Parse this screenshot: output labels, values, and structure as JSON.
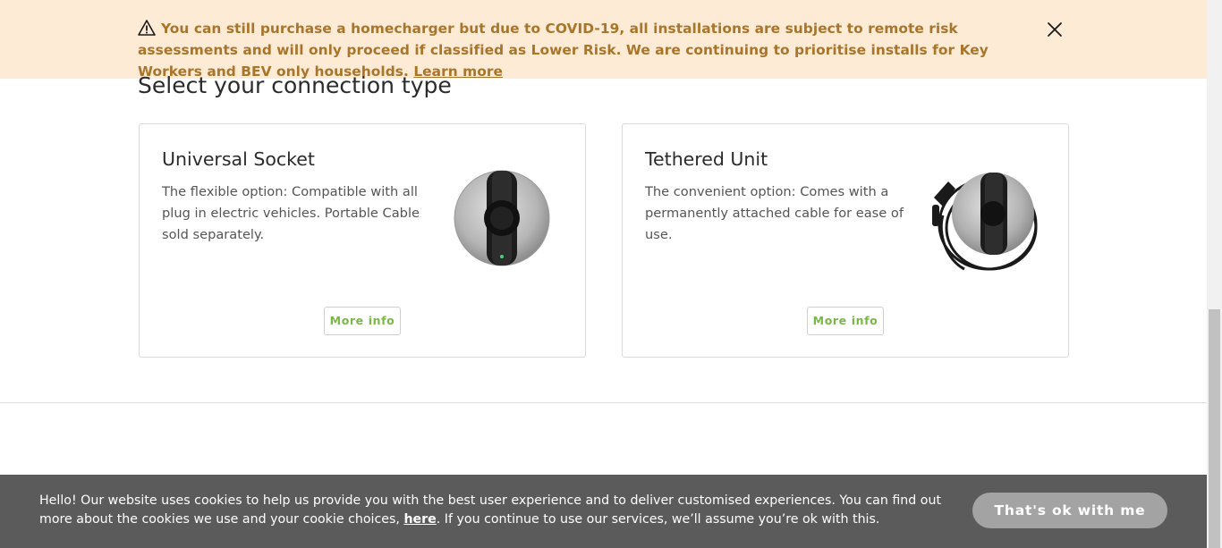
{
  "banner": {
    "icon": "warning-icon",
    "message": "You can still purchase a homecharger but due to COVID-19, all installations are subject to remote risk assessments and will only proceed if classified as Lower Risk. We are continuing to prioritise installs for Key Workers and BEV only households.",
    "link_label": "Learn more",
    "close_icon": "close-icon",
    "text_color": "#a8752a",
    "background": "#fdebd6"
  },
  "section": {
    "title": "Select your connection type"
  },
  "cards": [
    {
      "title": "Universal Socket",
      "description": "The flexible option: Compatible with all plug in electric vehicles. Portable Cable sold separately.",
      "image": "universal-socket-charger-image",
      "button_label": "More info"
    },
    {
      "title": "Tethered Unit",
      "description": "The convenient option: Comes with a permanently attached cable for ease of use.",
      "image": "tethered-unit-charger-image",
      "button_label": "More info"
    }
  ],
  "cookie": {
    "text_before": "Hello! Our website uses cookies to help us provide you with the best user experience and to deliver customised experiences. You can find out more about the cookies we use and your cookie choices, ",
    "link_label": "here",
    "text_after": ". If you continue to use our services, we’ll assume you’re ok with this.",
    "button_label": "That's ok with me"
  },
  "colors": {
    "accent_green": "#7ab648",
    "cookie_bar": "#5b5b5b"
  }
}
